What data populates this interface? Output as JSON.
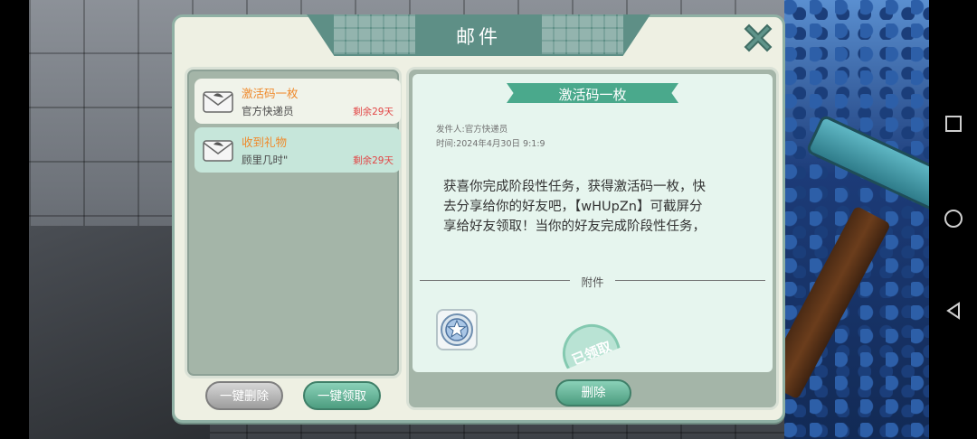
{
  "dialog": {
    "title": "邮件"
  },
  "mail_list": [
    {
      "subject": "激活码一枚",
      "sender": "官方快递员",
      "remaining": "剩余29天",
      "selected": true
    },
    {
      "subject": "收到礼物",
      "sender": "顾里几时\"",
      "remaining": "剩余29天",
      "selected": false
    }
  ],
  "list_buttons": {
    "delete_all": "一键删除",
    "claim_all": "一键领取"
  },
  "detail": {
    "subject": "激活码一枚",
    "sender_line": "发件人:官方快递员",
    "time_line": "时间:2024年4月30日 9:1:9",
    "body_lines": [
      "获喜你完成阶段性任务，获得激活码一枚，快",
      "去分享给你的好友吧，【wHUpZn】可截屏分",
      "享给好友领取！当你的好友完成阶段性任务，"
    ],
    "attachment_label": "附件",
    "attachment_icon": "star-badge-icon",
    "claimed_stamp": "已领取",
    "delete_button": "删除"
  },
  "colors": {
    "accent": "#4aa98c",
    "subject_orange": "#ef8a2c",
    "remaining_red": "#e24545"
  }
}
